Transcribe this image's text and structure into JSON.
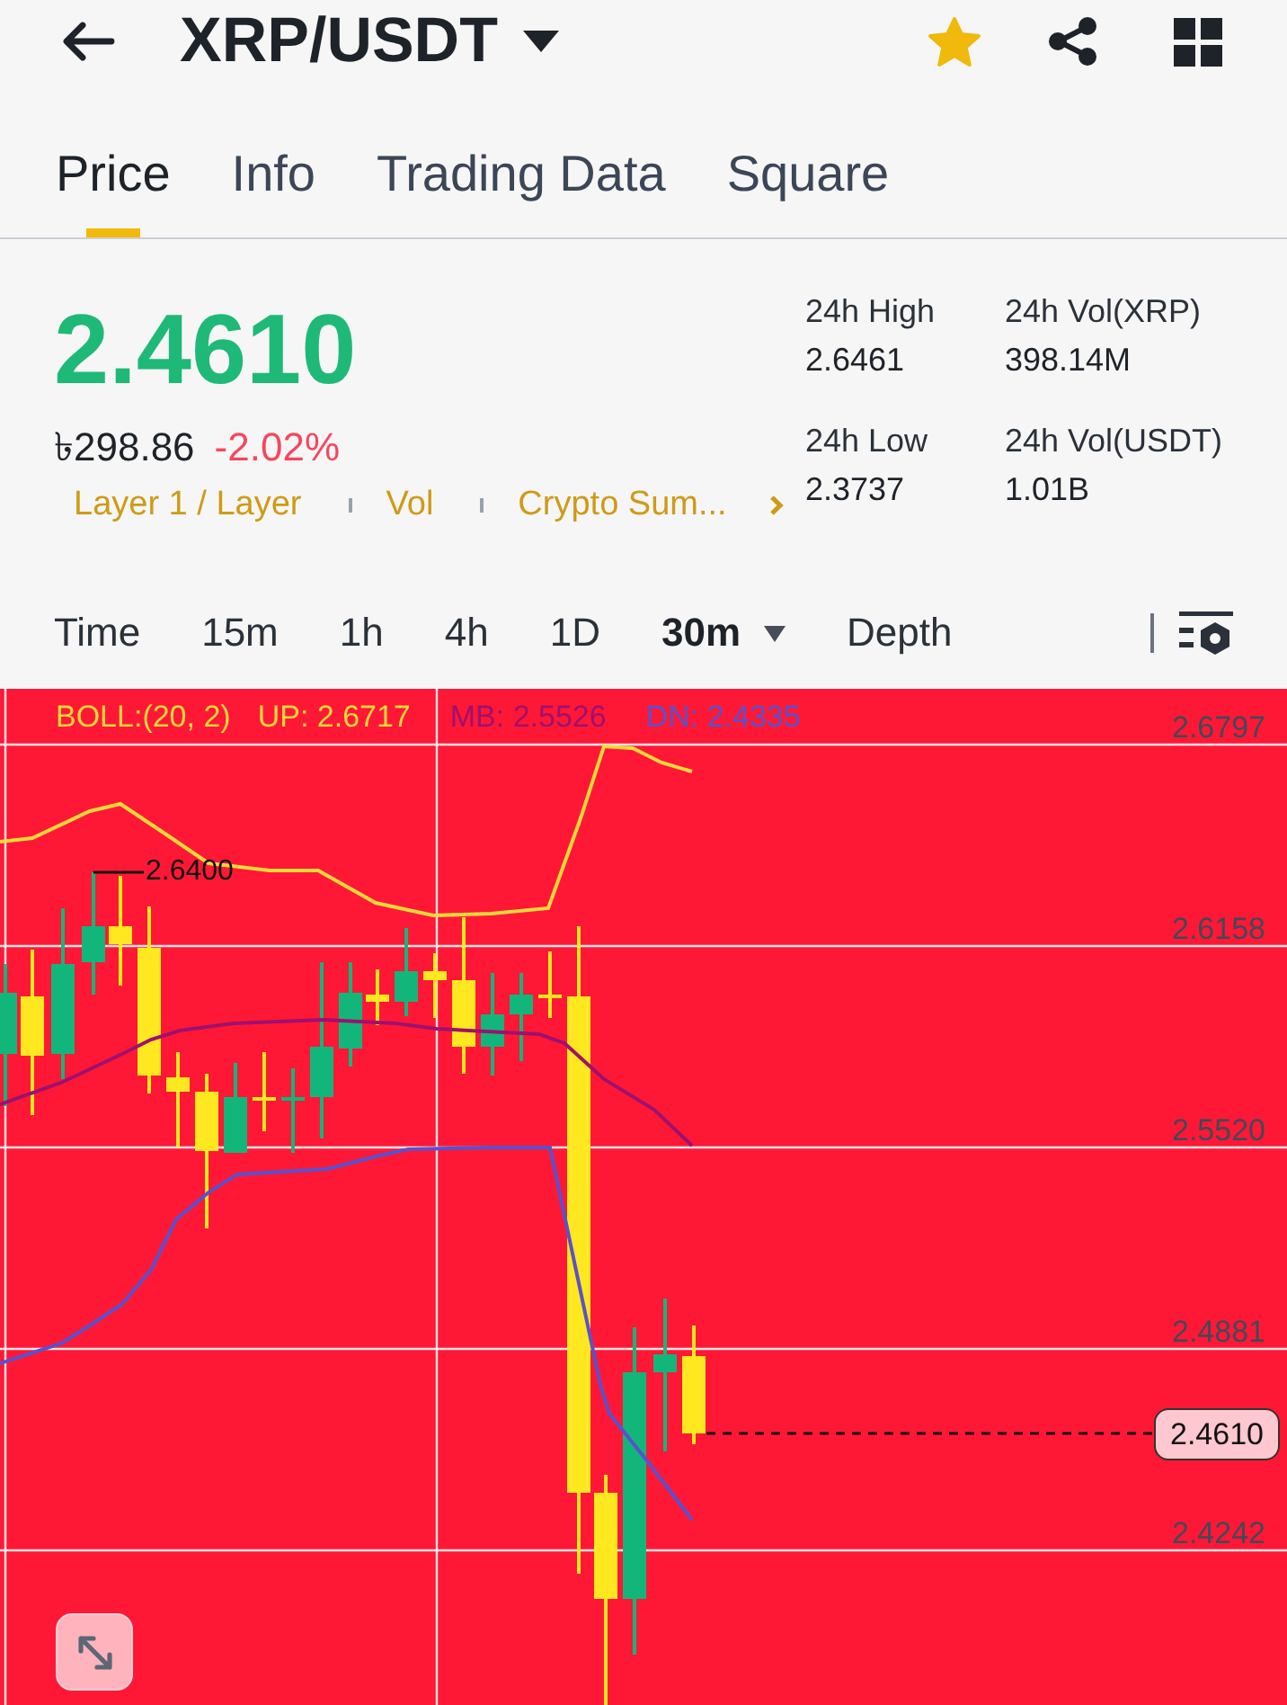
{
  "header": {
    "title": "XRP/USDT",
    "favorite": true
  },
  "tabs": [
    {
      "label": "Price",
      "selected": true
    },
    {
      "label": "Info",
      "selected": false
    },
    {
      "label": "Trading Data",
      "selected": false
    },
    {
      "label": "Square",
      "selected": false
    }
  ],
  "ticker": {
    "last_price": "2.4610",
    "local_price": "৳298.86",
    "change": "-2.02%",
    "tags": [
      "Layer 1 / Layer",
      "Vol",
      "Crypto Sum..."
    ]
  },
  "stats": [
    {
      "label": "24h High",
      "value": "2.6461"
    },
    {
      "label": "24h Vol(XRP)",
      "value": "398.14M"
    },
    {
      "label": "24h Low",
      "value": "2.3737"
    },
    {
      "label": "24h Vol(USDT)",
      "value": "1.01B"
    }
  ],
  "intervals": [
    {
      "label": "Time",
      "selected": false,
      "menu": false
    },
    {
      "label": "15m",
      "selected": false,
      "menu": false
    },
    {
      "label": "1h",
      "selected": false,
      "menu": false
    },
    {
      "label": "4h",
      "selected": false,
      "menu": false
    },
    {
      "label": "1D",
      "selected": false,
      "menu": false
    },
    {
      "label": "30m",
      "selected": true,
      "menu": true
    },
    {
      "label": "Depth",
      "selected": false,
      "menu": false
    }
  ],
  "chart": {
    "legend": [
      {
        "text": "BOLL:(20, 2)",
        "color": "#f7d93a"
      },
      {
        "text": "UP: 2.6717",
        "color": "#f7d93a"
      },
      {
        "text": "MB: 2.5526",
        "color": "#a0106e"
      },
      {
        "text": "DN: 2.4335",
        "color": "#5a51cc"
      }
    ],
    "price_axis": [
      "2.6797",
      "2.6158",
      "2.5520",
      "2.4881",
      "2.4242"
    ],
    "high_marker": "2.6400",
    "last_price_tag": "2.4610"
  }
}
